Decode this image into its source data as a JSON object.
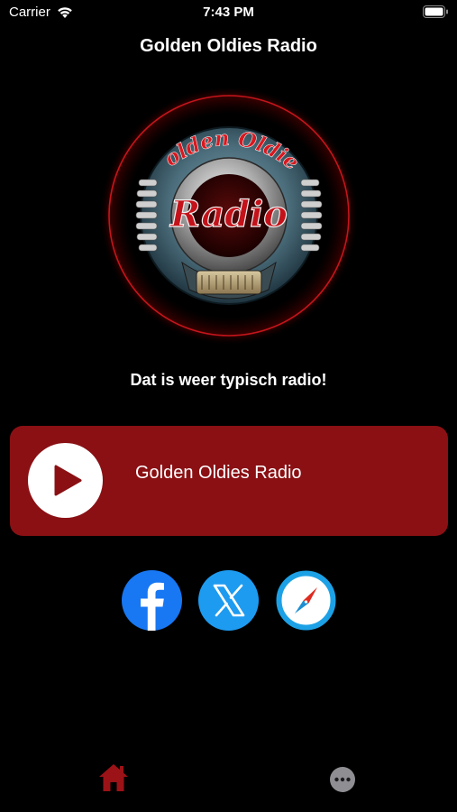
{
  "status_bar": {
    "carrier": "Carrier",
    "time": "7:43 PM",
    "icons": [
      "wifi-icon",
      "battery-icon"
    ]
  },
  "header": {
    "title": "Golden Oldies Radio"
  },
  "logo": {
    "top_text": "Golden Oldies",
    "main_text": "Radio"
  },
  "slogan": "Dat is weer typisch radio!",
  "player": {
    "station_name": "Golden Oldies Radio",
    "state": "paused",
    "icon": "play-icon"
  },
  "social": [
    {
      "name": "facebook",
      "icon": "facebook-icon",
      "color": "#1877f2"
    },
    {
      "name": "x",
      "icon": "x-icon",
      "color": "#1d9bf0"
    },
    {
      "name": "website",
      "icon": "compass-icon",
      "color": "#1da1e6"
    }
  ],
  "tab_bar": {
    "items": [
      {
        "name": "home",
        "icon": "home-icon",
        "active": true,
        "color": "#9b1217"
      },
      {
        "name": "more",
        "icon": "more-icon",
        "active": false,
        "color": "#8e8e93"
      }
    ]
  },
  "colors": {
    "background": "#000000",
    "accent": "#8a1014"
  }
}
